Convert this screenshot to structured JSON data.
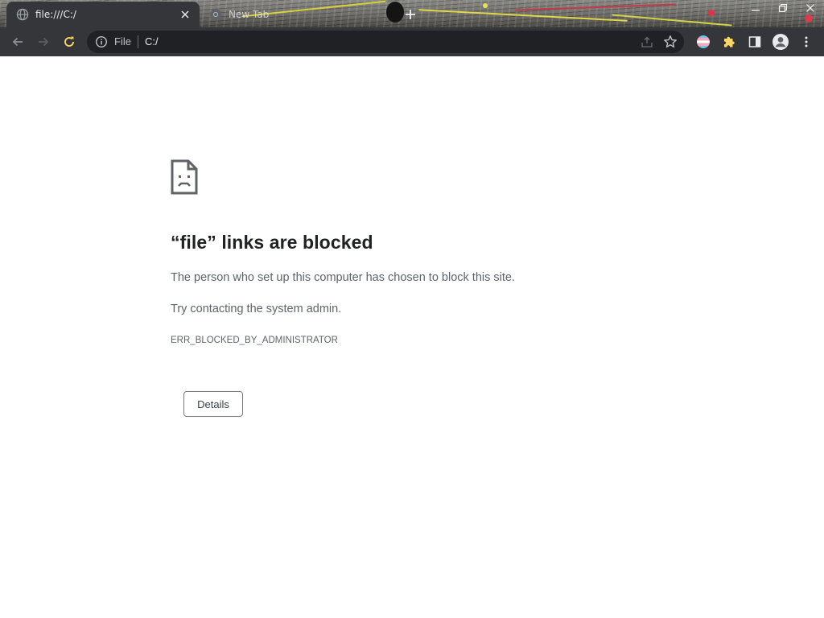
{
  "window": {
    "tabs": [
      {
        "title": "file:///C:/",
        "active": true
      },
      {
        "title": "New Tab",
        "active": false
      }
    ],
    "controls": [
      "minimize-icon",
      "restore-icon",
      "close-icon"
    ]
  },
  "toolbar": {
    "buttons": [
      "back-icon",
      "forward-icon",
      "reload-icon"
    ],
    "omnibox": {
      "scheme_label": "File",
      "url": "C:/"
    },
    "extension_icons": [
      "flag-extension-icon",
      "puzzle-extensions-icon",
      "side-panel-icon",
      "profile-avatar-icon",
      "more-menu-icon"
    ]
  },
  "error": {
    "icon": "sad-document-icon",
    "title": "“file” links are blocked",
    "message": "The person who set up this computer has chosen to block this site.",
    "suggestion": "Try contacting the system admin.",
    "code": "ERR_BLOCKED_BY_ADMINISTRATOR",
    "details_button": "Details"
  },
  "colors": {
    "toolbar_bg": "#35363a",
    "omnibox_bg": "#202124",
    "reload_accent": "#fdd663",
    "page_bg": "#ffffff",
    "headline_text": "#202124",
    "body_text": "#5f6368"
  }
}
